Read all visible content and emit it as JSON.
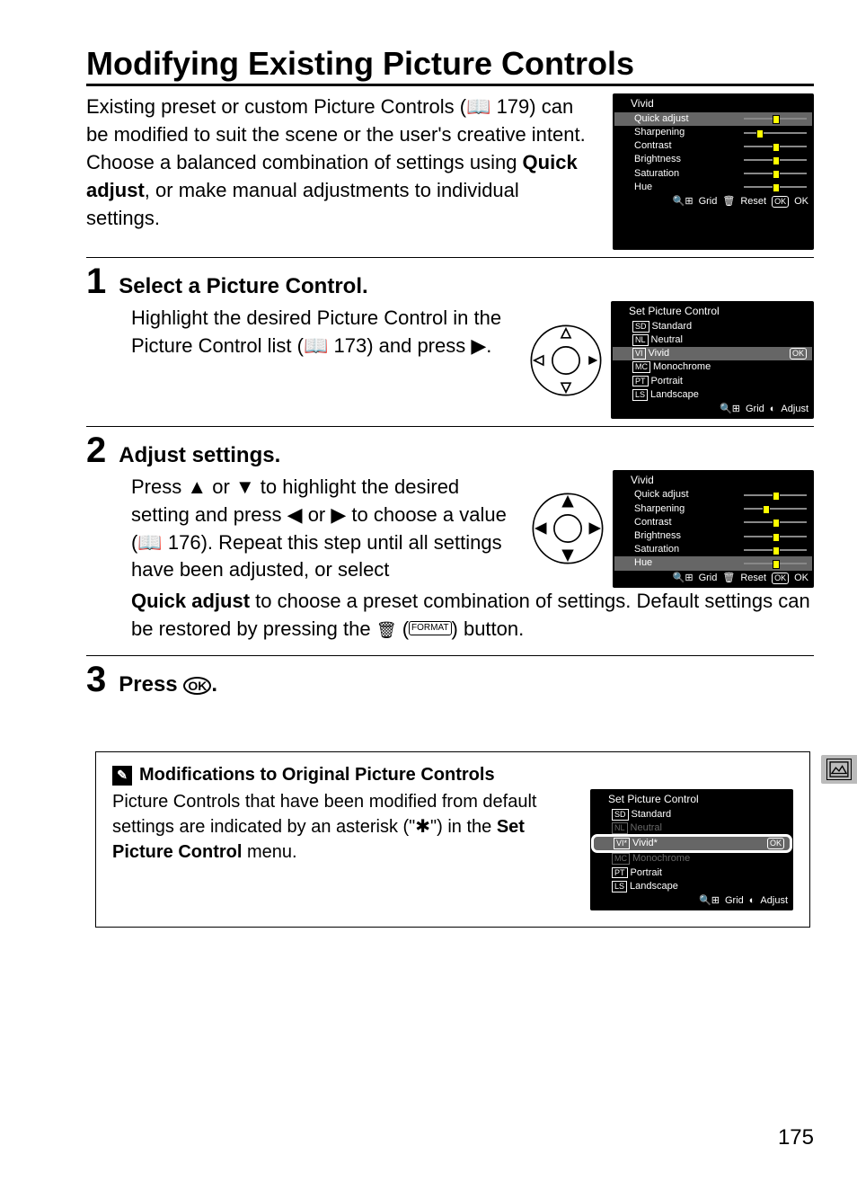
{
  "page_title": "Modifying Existing Picture Controls",
  "intro_text_pre": "Existing preset or custom Picture Controls (",
  "intro_ref": "179",
  "intro_text_mid": ") can be modified to suit the scene or the user's creative intent.  Choose a balanced combination of settings using ",
  "intro_bold": "Quick adjust",
  "intro_text_post": ", or make manual adjustments to individual settings.",
  "steps": {
    "s1": {
      "num": "1",
      "title": "Select a Picture Control.",
      "body_pre": "Highlight the desired Picture Control in the Picture Control list (",
      "body_ref": "173",
      "body_post": ") and press ▶."
    },
    "s2": {
      "num": "2",
      "title": "Adjust settings.",
      "body_a": "Press ▲ or ▼ to highlight the desired setting and press ◀ or ▶ to choose a value (",
      "body_a_ref": "176",
      "body_a_post": "). Repeat this step until all settings have been adjusted, or select ",
      "body_bold": "Quick adjust",
      "body_b": " to choose a preset combination of settings.  Default settings can be restored by pressing the ",
      "body_c": " (",
      "body_d": ") button."
    },
    "s3": {
      "num": "3",
      "title_pre": "Press ",
      "title_post": "."
    }
  },
  "lcd_vivid": {
    "title": "Vivid",
    "rows": [
      "Quick adjust",
      "Sharpening",
      "Contrast",
      "Brightness",
      "Saturation",
      "Hue"
    ],
    "foot_grid": "Grid",
    "foot_reset": "Reset",
    "foot_ok": "OK"
  },
  "lcd_set": {
    "title": "Set Picture Control",
    "rows": [
      {
        "code": "SD",
        "label": "Standard"
      },
      {
        "code": "NL",
        "label": "Neutral"
      },
      {
        "code": "VI",
        "label": "Vivid"
      },
      {
        "code": "MC",
        "label": "Monochrome"
      },
      {
        "code": "PT",
        "label": "Portrait"
      },
      {
        "code": "LS",
        "label": "Landscape"
      }
    ],
    "foot_grid": "Grid",
    "foot_adjust": "Adjust"
  },
  "lcd_set_mod": {
    "title": "Set Picture Control",
    "rows": [
      {
        "code": "SD",
        "label": "Standard"
      },
      {
        "code": "NL",
        "label": "Neutral"
      },
      {
        "code": "VI*",
        "label": "Vivid*"
      },
      {
        "code": "MC",
        "label": "Monochrome"
      },
      {
        "code": "PT",
        "label": "Portrait"
      },
      {
        "code": "LS",
        "label": "Landscape"
      }
    ],
    "foot_grid": "Grid",
    "foot_adjust": "Adjust"
  },
  "note": {
    "head": "Modifications to Original Picture Controls",
    "body_pre": "Picture Controls that have been modified from default settings are indicated by an asterisk (\"",
    "body_star": "✱",
    "body_mid": "\") in the ",
    "body_bold": "Set Picture Control",
    "body_post": " menu."
  },
  "page_number": "175",
  "glyphs": {
    "book": "📖",
    "format": "FORMAT",
    "ok_circle": "⊛"
  }
}
